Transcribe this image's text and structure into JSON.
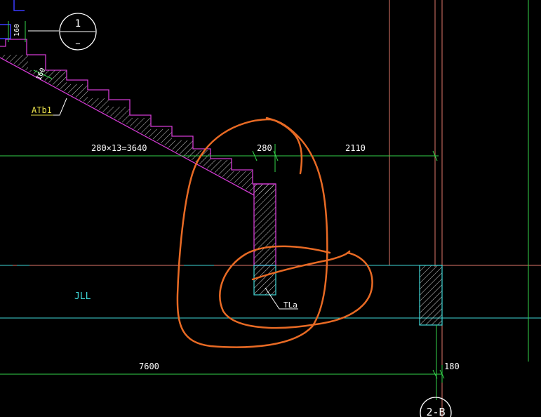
{
  "colors": {
    "background": "#000000",
    "dimension": "#34d34a",
    "stair_outline": "#d23bd2",
    "hatch": "#ffffff",
    "beam": "#3fd6d6",
    "axis": "#e0786a",
    "markup": "#e86a24",
    "label_yellow": "#e8e04a",
    "column_cyan": "#3fd6d6",
    "blue": "#3a3aff",
    "text_white": "#ffffff"
  },
  "dimensions": {
    "top_thickness": "160",
    "slab_thickness": "160",
    "flight_length": "280×13=3640",
    "landing_step": "280",
    "right_span": "2110",
    "bottom_span": "7600",
    "bottom_right": "180"
  },
  "labels": {
    "stair_slab": "ATb1",
    "beam": "JLL",
    "stair_beam": "TLa",
    "axis_bubble_top": "1",
    "axis_bubble_top_sub": "−",
    "axis_bubble_bottom": "2-B"
  }
}
